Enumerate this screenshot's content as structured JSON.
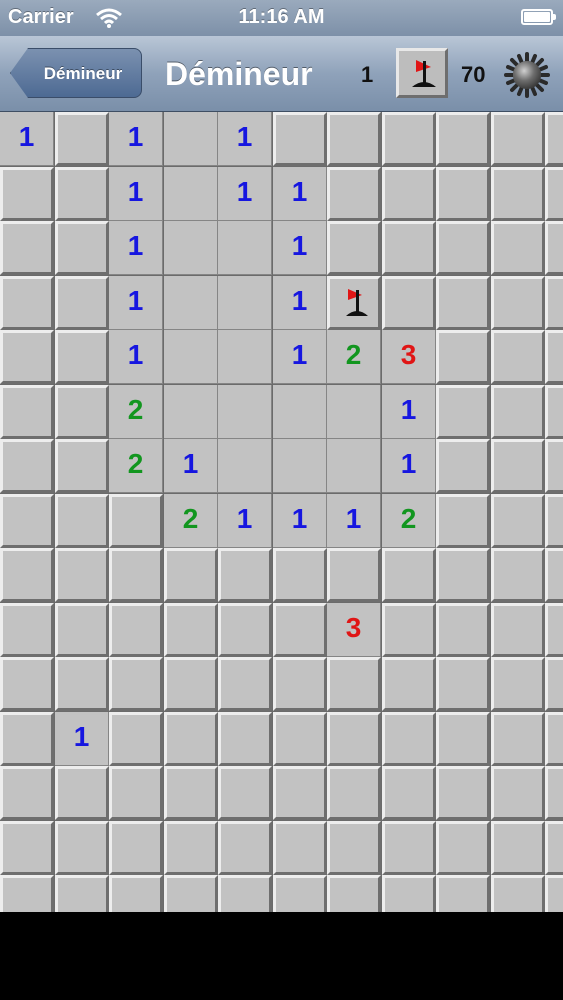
{
  "status_bar": {
    "carrier": "Carrier",
    "time": "11:16 AM"
  },
  "nav": {
    "back_label": "Démineur",
    "title": "Démineur",
    "flags_placed": "1",
    "mines_remaining": "70"
  },
  "colors": {
    "number_1": "#1616e0",
    "number_2": "#12961f",
    "number_3": "#e01515",
    "flag": "#e01515"
  },
  "icons": {
    "wifi": "wifi-icon",
    "battery": "battery-icon",
    "flag": "flag-icon",
    "mine": "mine-icon"
  },
  "board": {
    "legend": "C = covered, digit = revealed with count, . = revealed empty, F = flag",
    "rows": [
      [
        "1",
        "C",
        "1",
        ".",
        "1",
        "C",
        "C",
        "C",
        "C",
        "C",
        "C"
      ],
      [
        "C",
        "C",
        "1",
        ".",
        "1",
        "1",
        "C",
        "C",
        "C",
        "C",
        "C"
      ],
      [
        "C",
        "C",
        "1",
        ".",
        ".",
        "1",
        "C",
        "C",
        "C",
        "C",
        "C"
      ],
      [
        "C",
        "C",
        "1",
        ".",
        ".",
        "1",
        "F",
        "C",
        "C",
        "C",
        "C"
      ],
      [
        "C",
        "C",
        "1",
        ".",
        ".",
        "1",
        "2",
        "3",
        "C",
        "C",
        "C"
      ],
      [
        "C",
        "C",
        "2",
        ".",
        ".",
        ".",
        ".",
        "1",
        "C",
        "C",
        "C"
      ],
      [
        "C",
        "C",
        "2",
        "1",
        ".",
        ".",
        ".",
        "1",
        "C",
        "C",
        "C"
      ],
      [
        "C",
        "C",
        "C",
        "2",
        "1",
        "1",
        "1",
        "2",
        "C",
        "C",
        "C"
      ],
      [
        "C",
        "C",
        "C",
        "C",
        "C",
        "C",
        "C",
        "C",
        "C",
        "C",
        "C"
      ],
      [
        "C",
        "C",
        "C",
        "C",
        "C",
        "C",
        "3",
        "C",
        "C",
        "C",
        "C"
      ],
      [
        "C",
        "C",
        "C",
        "C",
        "C",
        "C",
        "C",
        "C",
        "C",
        "C",
        "C"
      ],
      [
        "C",
        "1",
        "C",
        "C",
        "C",
        "C",
        "C",
        "C",
        "C",
        "C",
        "C"
      ],
      [
        "C",
        "C",
        "C",
        "C",
        "C",
        "C",
        "C",
        "C",
        "C",
        "C",
        "C"
      ],
      [
        "C",
        "C",
        "C",
        "C",
        "C",
        "C",
        "C",
        "C",
        "C",
        "C",
        "C"
      ],
      [
        "C",
        "C",
        "C",
        "C",
        "C",
        "C",
        "C",
        "C",
        "C",
        "C",
        "C"
      ]
    ]
  }
}
